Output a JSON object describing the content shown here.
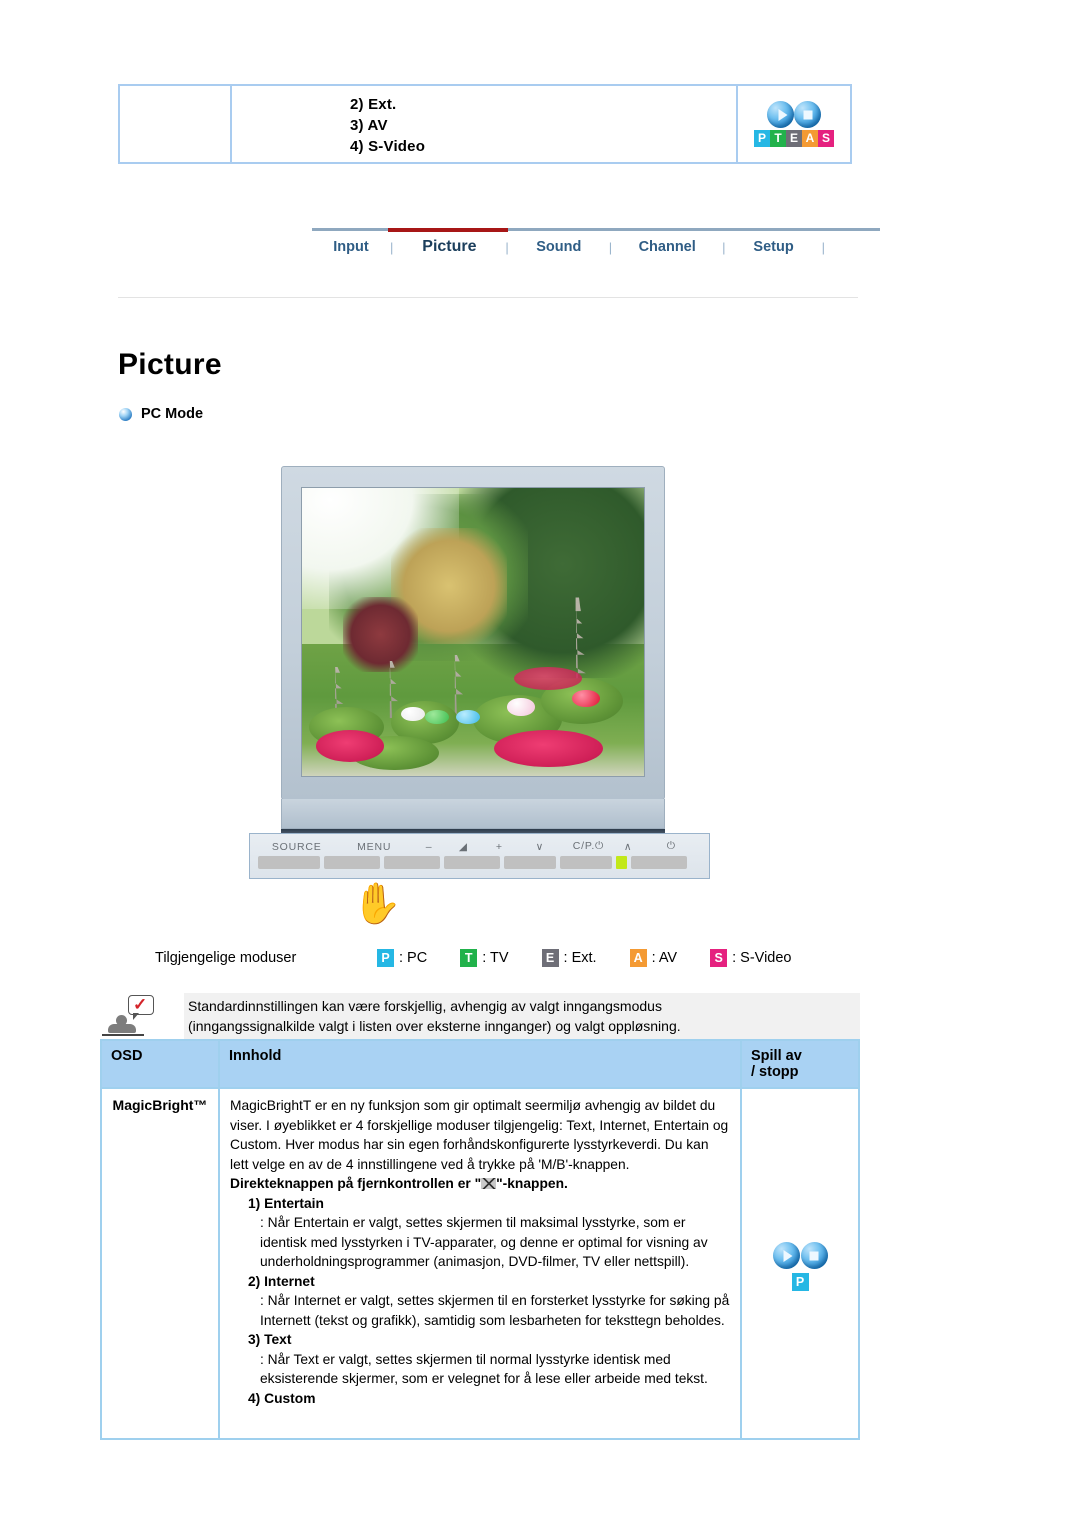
{
  "top_box": {
    "lines": [
      "2) Ext.",
      "3) AV",
      "4) S-Video"
    ],
    "logo": {
      "letters": [
        "P",
        "T",
        "E",
        "A",
        "S"
      ],
      "colors": [
        "#25b7e4",
        "#21b24b",
        "#6e6e77",
        "#f49a33",
        "#e5217f"
      ],
      "ball_play": "play-icon",
      "ball_stop": "stop-icon"
    }
  },
  "tabs": {
    "items": [
      {
        "label": "Input",
        "active": false
      },
      {
        "label": "Picture",
        "active": true
      },
      {
        "label": "Sound",
        "active": false
      },
      {
        "label": "Channel",
        "active": false
      },
      {
        "label": "Setup",
        "active": false
      }
    ],
    "separator": "|",
    "active_underline_color": "#a71616"
  },
  "page": {
    "title": "Picture",
    "section_label": "PC Mode"
  },
  "monitor": {
    "control_panel": {
      "labels": [
        "SOURCE",
        "MENU",
        "–",
        "◢",
        "+",
        "∨",
        "C/P.⏻",
        "∧",
        "⏻"
      ],
      "led_color": "#c2e81a"
    }
  },
  "modes": {
    "label": "Tilgjengelige moduser",
    "items": [
      {
        "badge": "P",
        "text": ": PC",
        "color": "#25b7e4"
      },
      {
        "badge": "T",
        "text": ": TV",
        "color": "#21b24b"
      },
      {
        "badge": "E",
        "text": ": Ext.",
        "color": "#6e6e77"
      },
      {
        "badge": "A",
        "text": ": AV",
        "color": "#f49a33"
      },
      {
        "badge": "S",
        "text": ": S-Video",
        "color": "#e5217f"
      }
    ]
  },
  "note": {
    "line1": "Standardinnstillingen kan være forskjellig, avhengig av valgt inngangsmodus",
    "line2": "(inngangssignalkilde valgt i listen over eksterne innganger) og valgt oppløsning."
  },
  "table": {
    "headers": {
      "osd": "OSD",
      "content": "Innhold",
      "play_line1": "Spill av",
      "play_line2": "/ stopp"
    },
    "row": {
      "osd": "MagicBright™",
      "paragraph": "MagicBrightT er en ny funksjon som gir optimalt seermiljø avhengig av bildet du viser. I øyeblikket er 4 forskjellige moduser tilgjengelig: Text, Internet, Entertain og Custom. Hver modus har sin egen forhåndskonfigurerte lysstyrkeverdi. Du kan lett velge en av de 4 innstillingene ved å trykke på 'M/B'-knappen.",
      "direct_key_prefix": "Direkteknappen på fjernkontrollen er \"",
      "direct_key_suffix": "\"-knappen.",
      "items": [
        {
          "title": "1) Entertain",
          "desc": ": Når Entertain er valgt, settes skjermen til maksimal lysstyrke, som er identisk med lysstyrken i TV-apparater, og denne er optimal for visning av underholdningsprogrammer (animasjon, DVD-filmer, TV eller nettspill)."
        },
        {
          "title": "2) Internet",
          "desc": ": Når Internet er valgt, settes skjermen til en forsterket lysstyrke for søking på Internett (tekst og grafikk), samtidig som lesbarheten for teksttegn beholdes."
        },
        {
          "title": "3) Text",
          "desc": ": Når Text er valgt, settes skjermen til normal lysstyrke identisk med eksisterende skjermer, som er velegnet for å lese eller arbeide med tekst."
        },
        {
          "title": "4) Custom",
          "desc": ""
        }
      ],
      "play_badge": "P"
    }
  }
}
